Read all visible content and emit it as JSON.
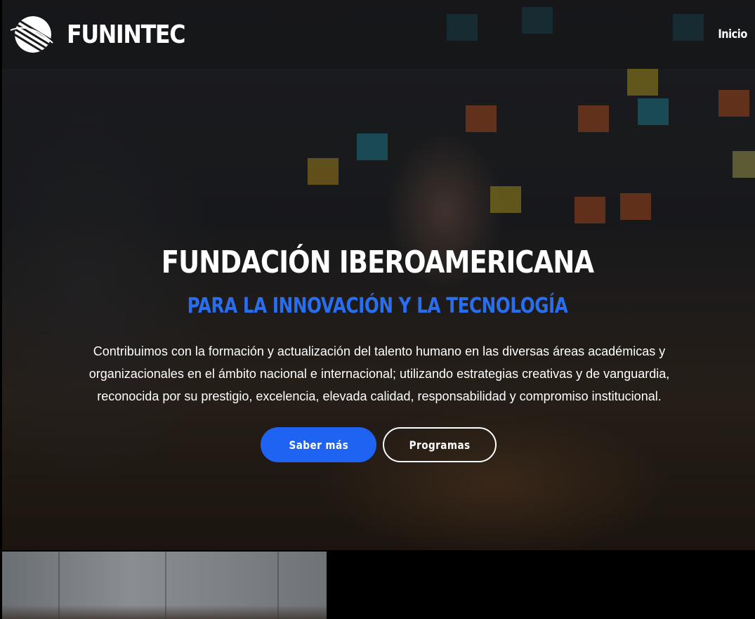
{
  "navbar": {
    "brand_name": "FUNINTEC",
    "logo_icon": "striped-globe-icon",
    "links": [
      {
        "label": "Inicio"
      }
    ]
  },
  "hero": {
    "title": "FUNDACIÓN IBEROAMERICANA",
    "subtitle": "PARA LA INNOVACIÓN Y LA TECNOLOGÍA",
    "description_lines": [
      "Contribuimos con la formación y actualización del talento humano en las diversas áreas académicas y",
      "organizacionales en el ámbito nacional e internacional; utilizando estrategias creativas y de vanguardia,",
      "reconocida por su prestigio, excelencia, elevada calidad, responsabilidad y compromiso institucional."
    ],
    "primary_button": "Saber más",
    "secondary_button": "Programas"
  },
  "colors": {
    "accent": "#1f63f2",
    "subtitle": "#2a6ef0",
    "navbar_bg": "rgba(20,20,22,0.55)"
  }
}
